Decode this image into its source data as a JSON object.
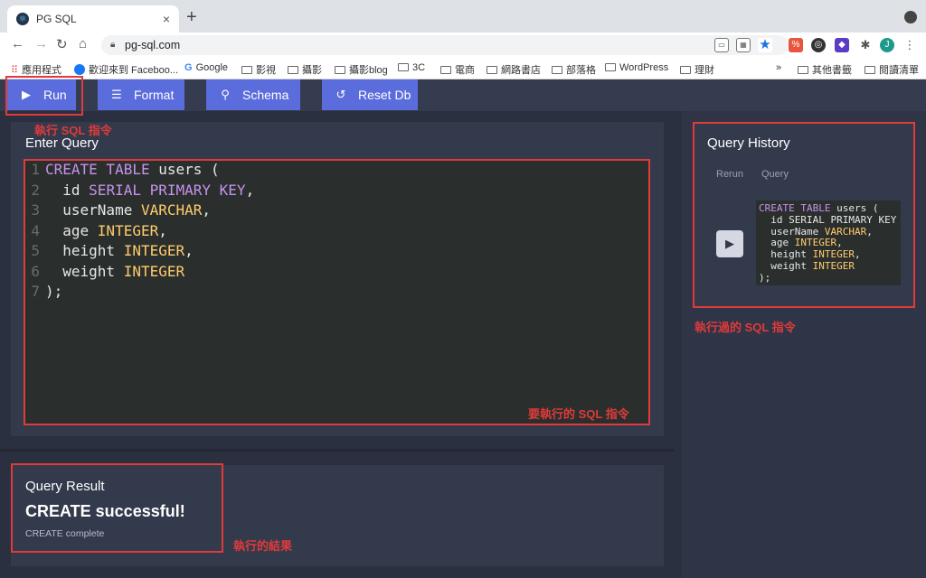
{
  "browser": {
    "tab_title": "PG SQL",
    "url": "pg-sql.com",
    "bookmarks": [
      "應用程式",
      "歡迎來到 Faceboo...",
      "Google",
      "影視",
      "攝影",
      "攝影blog",
      "3C",
      "電商",
      "網路書店",
      "部落格",
      "WordPress",
      "理財",
      "其他書籤",
      "閱讀清單"
    ]
  },
  "toolbar": {
    "run_label": "Run",
    "format_label": "Format",
    "schema_label": "Schema",
    "reset_label": "Reset Db"
  },
  "editor": {
    "title": "Enter Query",
    "lines": [
      [
        {
          "t": "CREATE TABLE ",
          "c": "kw"
        },
        {
          "t": "users (",
          "c": "pl"
        }
      ],
      [
        {
          "t": "  id ",
          "c": "pl"
        },
        {
          "t": "SERIAL PRIMARY KEY",
          "c": "kw"
        },
        {
          "t": ",",
          "c": "pl"
        }
      ],
      [
        {
          "t": "  userName ",
          "c": "pl"
        },
        {
          "t": "VARCHAR",
          "c": "ty"
        },
        {
          "t": ",",
          "c": "pl"
        }
      ],
      [
        {
          "t": "  age ",
          "c": "pl"
        },
        {
          "t": "INTEGER",
          "c": "ty"
        },
        {
          "t": ",",
          "c": "pl"
        }
      ],
      [
        {
          "t": "  height ",
          "c": "pl"
        },
        {
          "t": "INTEGER",
          "c": "ty"
        },
        {
          "t": ",",
          "c": "pl"
        }
      ],
      [
        {
          "t": "  weight ",
          "c": "pl"
        },
        {
          "t": "INTEGER",
          "c": "ty"
        }
      ],
      [
        {
          "t": ");",
          "c": "pl"
        }
      ]
    ]
  },
  "history": {
    "title": "Query History",
    "col_rerun": "Rerun",
    "col_query": "Query",
    "entries": [
      {
        "lines": [
          [
            {
              "t": "CREATE TABLE ",
              "c": "kw"
            },
            {
              "t": "users (",
              "c": "pl"
            }
          ],
          [
            {
              "t": "  id SERIAL PRIMARY KEY",
              "c": "pl"
            }
          ],
          [
            {
              "t": "  userName ",
              "c": "pl"
            },
            {
              "t": "VARCHAR",
              "c": "ty"
            },
            {
              "t": ",",
              "c": "pl"
            }
          ],
          [
            {
              "t": "  age ",
              "c": "pl"
            },
            {
              "t": "INTEGER",
              "c": "ty"
            },
            {
              "t": ",",
              "c": "pl"
            }
          ],
          [
            {
              "t": "  height ",
              "c": "pl"
            },
            {
              "t": "INTEGER",
              "c": "ty"
            },
            {
              "t": ",",
              "c": "pl"
            }
          ],
          [
            {
              "t": "  weight ",
              "c": "pl"
            },
            {
              "t": "INTEGER",
              "c": "ty"
            }
          ],
          [
            {
              "t": ");",
              "c": "pl"
            }
          ]
        ]
      }
    ]
  },
  "result": {
    "title": "Query Result",
    "message": "CREATE successful!",
    "detail": "CREATE complete"
  },
  "annotations": {
    "run": "執行 SQL 指令",
    "editor": "要執行的 SQL 指令",
    "history": "執行過的 SQL 指令",
    "result": "執行的結果"
  },
  "colors": {
    "accent": "#5b6cdc",
    "annotation_red": "#e03a3a",
    "keyword": "#c792ea",
    "type": "#ffcb6b"
  }
}
